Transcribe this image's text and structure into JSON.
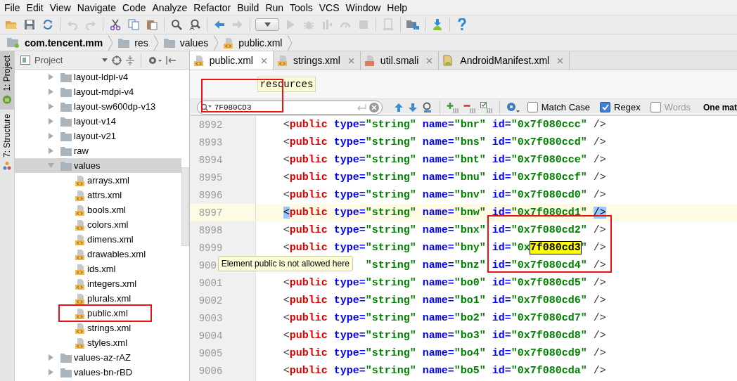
{
  "menu": [
    "File",
    "Edit",
    "View",
    "Navigate",
    "Code",
    "Analyze",
    "Refactor",
    "Build",
    "Run",
    "Tools",
    "VCS",
    "Window",
    "Help"
  ],
  "toolbar": [
    {
      "kind": "open",
      "disabled": false
    },
    {
      "kind": "save",
      "disabled": false
    },
    {
      "kind": "sync",
      "disabled": false
    },
    {
      "kind": "separator"
    },
    {
      "kind": "undo",
      "disabled": true
    },
    {
      "kind": "redo",
      "disabled": true
    },
    {
      "kind": "separator"
    },
    {
      "kind": "cut",
      "disabled": false
    },
    {
      "kind": "copy",
      "disabled": false
    },
    {
      "kind": "paste",
      "disabled": false
    },
    {
      "kind": "separator"
    },
    {
      "kind": "find",
      "disabled": false
    },
    {
      "kind": "replace",
      "disabled": false
    },
    {
      "kind": "separator"
    },
    {
      "kind": "back",
      "disabled": false
    },
    {
      "kind": "forward",
      "disabled": true
    },
    {
      "kind": "separator"
    },
    {
      "kind": "run-config",
      "disabled": false
    },
    {
      "kind": "run",
      "disabled": true
    },
    {
      "kind": "debug",
      "disabled": true
    },
    {
      "kind": "coverage",
      "disabled": true
    },
    {
      "kind": "profile",
      "disabled": true
    },
    {
      "kind": "stop",
      "disabled": true
    },
    {
      "kind": "separator"
    },
    {
      "kind": "device",
      "disabled": true
    },
    {
      "kind": "separator"
    },
    {
      "kind": "structure",
      "disabled": false
    },
    {
      "kind": "separator"
    },
    {
      "kind": "sdk",
      "disabled": false
    },
    {
      "kind": "separator"
    },
    {
      "kind": "help",
      "disabled": false
    }
  ],
  "breadcrumb": [
    {
      "label": "com.tencent.mm",
      "kind": "module"
    },
    {
      "label": "res",
      "kind": "folder"
    },
    {
      "label": "values",
      "kind": "folder"
    },
    {
      "label": "public.xml",
      "kind": "xml"
    }
  ],
  "side_tabs": [
    {
      "label": "1: Project",
      "kind": "project",
      "selected": true
    },
    {
      "label": "7: Structure",
      "kind": "structure",
      "selected": false
    }
  ],
  "project_panel": {
    "title": "Project",
    "tree": [
      {
        "label": "layout-ldpi-v4",
        "kind": "folder",
        "expanded": false,
        "selected": false
      },
      {
        "label": "layout-mdpi-v4",
        "kind": "folder",
        "expanded": false,
        "selected": false
      },
      {
        "label": "layout-sw600dp-v13",
        "kind": "folder",
        "expanded": false,
        "selected": false
      },
      {
        "label": "layout-v14",
        "kind": "folder",
        "expanded": false,
        "selected": false
      },
      {
        "label": "layout-v21",
        "kind": "folder",
        "expanded": false,
        "selected": false
      },
      {
        "label": "raw",
        "kind": "folder",
        "expanded": false,
        "selected": false
      },
      {
        "label": "values",
        "kind": "folder",
        "expanded": true,
        "selected": true,
        "children": [
          {
            "label": "arrays.xml",
            "kind": "xml",
            "selected": false
          },
          {
            "label": "attrs.xml",
            "kind": "xml",
            "selected": false
          },
          {
            "label": "bools.xml",
            "kind": "xml",
            "selected": false
          },
          {
            "label": "colors.xml",
            "kind": "xml",
            "selected": false
          },
          {
            "label": "dimens.xml",
            "kind": "xml",
            "selected": false
          },
          {
            "label": "drawables.xml",
            "kind": "xml",
            "selected": false
          },
          {
            "label": "ids.xml",
            "kind": "xml",
            "selected": false
          },
          {
            "label": "integers.xml",
            "kind": "xml",
            "selected": false
          },
          {
            "label": "plurals.xml",
            "kind": "xml",
            "selected": false
          },
          {
            "label": "public.xml",
            "kind": "xml",
            "selected": false
          },
          {
            "label": "strings.xml",
            "kind": "xml",
            "selected": false
          },
          {
            "label": "styles.xml",
            "kind": "xml",
            "selected": false
          }
        ]
      },
      {
        "label": "values-az-rAZ",
        "kind": "folder",
        "expanded": false,
        "selected": false
      },
      {
        "label": "values-bn-rBD",
        "kind": "folder",
        "expanded": false,
        "selected": false
      }
    ]
  },
  "editor_tabs": [
    {
      "label": "public.xml",
      "kind": "xml",
      "selected": true
    },
    {
      "label": "strings.xml",
      "kind": "xml",
      "selected": false
    },
    {
      "label": "util.smali",
      "kind": "smali",
      "selected": false
    },
    {
      "label": "AndroidManifest.xml",
      "kind": "manifest",
      "selected": false
    }
  ],
  "breadcrumb_tooltip": "resources",
  "search": {
    "value": "7F080CD3",
    "options": [
      {
        "label": "Match Case",
        "checked": false,
        "disabled": false
      },
      {
        "label": "Regex",
        "checked": true,
        "disabled": false
      },
      {
        "label": "Words",
        "checked": false,
        "disabled": true
      }
    ],
    "status": "One mat"
  },
  "lines": [
    {
      "number": "8992",
      "current": false,
      "kind": "full",
      "tokens": [
        {
          "kind": "punct",
          "text": "<"
        },
        {
          "kind": "tag",
          "text": "public"
        },
        {
          "kind": "attr",
          "text": " type="
        },
        {
          "kind": "value",
          "text": "\"string\""
        },
        {
          "kind": "attr",
          "text": " name="
        },
        {
          "kind": "value",
          "text": "\"bnr\""
        },
        {
          "kind": "attr",
          "text": " id="
        },
        {
          "kind": "value",
          "text": "\"0x7f080ccc\""
        },
        {
          "kind": "punct",
          "text": " />"
        }
      ]
    },
    {
      "number": "8993",
      "current": false,
      "kind": "full",
      "tokens": [
        {
          "kind": "punct",
          "text": "<"
        },
        {
          "kind": "tag",
          "text": "public"
        },
        {
          "kind": "attr",
          "text": " type="
        },
        {
          "kind": "value",
          "text": "\"string\""
        },
        {
          "kind": "attr",
          "text": " name="
        },
        {
          "kind": "value",
          "text": "\"bns\""
        },
        {
          "kind": "attr",
          "text": " id="
        },
        {
          "kind": "value",
          "text": "\"0x7f080ccd\""
        },
        {
          "kind": "punct",
          "text": " />"
        }
      ]
    },
    {
      "number": "8994",
      "current": false,
      "kind": "full",
      "tokens": [
        {
          "kind": "punct",
          "text": "<"
        },
        {
          "kind": "tag",
          "text": "public"
        },
        {
          "kind": "attr",
          "text": " type="
        },
        {
          "kind": "value",
          "text": "\"string\""
        },
        {
          "kind": "attr",
          "text": " name="
        },
        {
          "kind": "value",
          "text": "\"bnt\""
        },
        {
          "kind": "attr",
          "text": " id="
        },
        {
          "kind": "value",
          "text": "\"0x7f080cce\""
        },
        {
          "kind": "punct",
          "text": " />"
        }
      ]
    },
    {
      "number": "8995",
      "current": false,
      "kind": "full",
      "tokens": [
        {
          "kind": "punct",
          "text": "<"
        },
        {
          "kind": "tag",
          "text": "public"
        },
        {
          "kind": "attr",
          "text": " type="
        },
        {
          "kind": "value",
          "text": "\"string\""
        },
        {
          "kind": "attr",
          "text": " name="
        },
        {
          "kind": "value",
          "text": "\"bnu\""
        },
        {
          "kind": "attr",
          "text": " id="
        },
        {
          "kind": "value",
          "text": "\"0x7f080ccf\""
        },
        {
          "kind": "punct",
          "text": " />"
        }
      ]
    },
    {
      "number": "8996",
      "current": false,
      "kind": "full",
      "tokens": [
        {
          "kind": "punct",
          "text": "<"
        },
        {
          "kind": "tag",
          "text": "public"
        },
        {
          "kind": "attr",
          "text": " type="
        },
        {
          "kind": "value",
          "text": "\"string\""
        },
        {
          "kind": "attr",
          "text": " name="
        },
        {
          "kind": "value",
          "text": "\"bnv\""
        },
        {
          "kind": "attr",
          "text": " id="
        },
        {
          "kind": "value",
          "text": "\"0x7f080cd0\""
        },
        {
          "kind": "punct",
          "text": " />"
        }
      ]
    },
    {
      "number": "8997",
      "current": true,
      "kind": "full",
      "tokens": [
        {
          "kind": "brace",
          "text": "<"
        },
        {
          "kind": "tag",
          "text": "public"
        },
        {
          "kind": "attr",
          "text": " type="
        },
        {
          "kind": "value",
          "text": "\"string\""
        },
        {
          "kind": "attr",
          "text": " name="
        },
        {
          "kind": "value",
          "text": "\"bnw\""
        },
        {
          "kind": "attr",
          "text": " id="
        },
        {
          "kind": "value",
          "text": "\"0x7f080cd1\" "
        },
        {
          "kind": "brace",
          "text": "/>"
        }
      ]
    },
    {
      "number": "8998",
      "current": false,
      "kind": "full",
      "tokens": [
        {
          "kind": "punct",
          "text": "<"
        },
        {
          "kind": "tag",
          "text": "public"
        },
        {
          "kind": "attr",
          "text": " type="
        },
        {
          "kind": "value",
          "text": "\"string\""
        },
        {
          "kind": "attr",
          "text": " name="
        },
        {
          "kind": "value",
          "text": "\"bnx\""
        },
        {
          "kind": "attr",
          "text": " id="
        },
        {
          "kind": "value",
          "text": "\"0x7f080cd2\""
        },
        {
          "kind": "punct",
          "text": " />"
        }
      ]
    },
    {
      "number": "8999",
      "current": false,
      "kind": "full",
      "tokens": [
        {
          "kind": "punct",
          "text": "<"
        },
        {
          "kind": "tag",
          "text": "public"
        },
        {
          "kind": "attr",
          "text": " type="
        },
        {
          "kind": "value",
          "text": "\"string\""
        },
        {
          "kind": "attr",
          "text": " name="
        },
        {
          "kind": "value",
          "text": "\"bny\""
        },
        {
          "kind": "attr",
          "text": " id="
        },
        {
          "kind": "value",
          "text": "\"0x"
        },
        {
          "kind": "match",
          "text": "7f080cd3"
        },
        {
          "kind": "value",
          "text": "\""
        },
        {
          "kind": "punct",
          "text": " />"
        }
      ]
    },
    {
      "number": "900",
      "current": false,
      "kind": "partial",
      "tokens": [
        {
          "kind": "value",
          "text": "\"string\""
        },
        {
          "kind": "attr",
          "text": " name="
        },
        {
          "kind": "value",
          "text": "\"bnz\""
        },
        {
          "kind": "attr",
          "text": " id="
        },
        {
          "kind": "value",
          "text": "\"0x7f080cd4\""
        },
        {
          "kind": "punct",
          "text": " />"
        }
      ]
    },
    {
      "number": "9001",
      "current": false,
      "kind": "full",
      "tokens": [
        {
          "kind": "punct",
          "text": "<"
        },
        {
          "kind": "tag",
          "text": "public"
        },
        {
          "kind": "attr",
          "text": " type="
        },
        {
          "kind": "value",
          "text": "\"string\""
        },
        {
          "kind": "attr",
          "text": " name="
        },
        {
          "kind": "value",
          "text": "\"bo0\""
        },
        {
          "kind": "attr",
          "text": " id="
        },
        {
          "kind": "value",
          "text": "\"0x7f080cd5\""
        },
        {
          "kind": "punct",
          "text": " />"
        }
      ]
    },
    {
      "number": "9002",
      "current": false,
      "kind": "full",
      "tokens": [
        {
          "kind": "punct",
          "text": "<"
        },
        {
          "kind": "tag",
          "text": "public"
        },
        {
          "kind": "attr",
          "text": " type="
        },
        {
          "kind": "value",
          "text": "\"string\""
        },
        {
          "kind": "attr",
          "text": " name="
        },
        {
          "kind": "value",
          "text": "\"bo1\""
        },
        {
          "kind": "attr",
          "text": " id="
        },
        {
          "kind": "value",
          "text": "\"0x7f080cd6\""
        },
        {
          "kind": "punct",
          "text": " />"
        }
      ]
    },
    {
      "number": "9003",
      "current": false,
      "kind": "full",
      "tokens": [
        {
          "kind": "punct",
          "text": "<"
        },
        {
          "kind": "tag",
          "text": "public"
        },
        {
          "kind": "attr",
          "text": " type="
        },
        {
          "kind": "value",
          "text": "\"string\""
        },
        {
          "kind": "attr",
          "text": " name="
        },
        {
          "kind": "value",
          "text": "\"bo2\""
        },
        {
          "kind": "attr",
          "text": " id="
        },
        {
          "kind": "value",
          "text": "\"0x7f080cd7\""
        },
        {
          "kind": "punct",
          "text": " />"
        }
      ]
    },
    {
      "number": "9004",
      "current": false,
      "kind": "full",
      "tokens": [
        {
          "kind": "punct",
          "text": "<"
        },
        {
          "kind": "tag",
          "text": "public"
        },
        {
          "kind": "attr",
          "text": " type="
        },
        {
          "kind": "value",
          "text": "\"string\""
        },
        {
          "kind": "attr",
          "text": " name="
        },
        {
          "kind": "value",
          "text": "\"bo3\""
        },
        {
          "kind": "attr",
          "text": " id="
        },
        {
          "kind": "value",
          "text": "\"0x7f080cd8\""
        },
        {
          "kind": "punct",
          "text": " />"
        }
      ]
    },
    {
      "number": "9005",
      "current": false,
      "kind": "full",
      "tokens": [
        {
          "kind": "punct",
          "text": "<"
        },
        {
          "kind": "tag",
          "text": "public"
        },
        {
          "kind": "attr",
          "text": " type="
        },
        {
          "kind": "value",
          "text": "\"string\""
        },
        {
          "kind": "attr",
          "text": " name="
        },
        {
          "kind": "value",
          "text": "\"bo4\""
        },
        {
          "kind": "attr",
          "text": " id="
        },
        {
          "kind": "value",
          "text": "\"0x7f080cd9\""
        },
        {
          "kind": "punct",
          "text": " />"
        }
      ]
    },
    {
      "number": "9006",
      "current": false,
      "kind": "full",
      "tokens": [
        {
          "kind": "punct",
          "text": "<"
        },
        {
          "kind": "tag",
          "text": "public"
        },
        {
          "kind": "attr",
          "text": " type="
        },
        {
          "kind": "value",
          "text": "\"string\""
        },
        {
          "kind": "attr",
          "text": " name="
        },
        {
          "kind": "value",
          "text": "\"bo5\""
        },
        {
          "kind": "attr",
          "text": " id="
        },
        {
          "kind": "value",
          "text": "\"0x7f080cda\""
        },
        {
          "kind": "punct",
          "text": " />"
        }
      ]
    }
  ],
  "error_tooltip": "Element public is not allowed here"
}
